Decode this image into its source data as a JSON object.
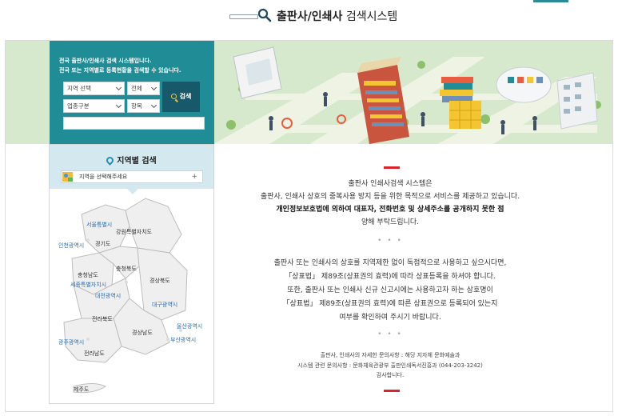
{
  "header": {
    "title_strong": "출판사/인쇄사",
    "title_rest": " 검색시스템"
  },
  "search": {
    "intro_line1": "전국 출판사/인쇄사 검색 시스템입니다.",
    "intro_line2": "전국 또는 지역별로 등록현황을 검색할 수 있습니다.",
    "region_select": "지역 선택",
    "scope_select": "전체",
    "business_select": "업종구분",
    "field_select": "항목",
    "button_label": "검색",
    "keyword_value": ""
  },
  "region": {
    "title": "지역별 검색",
    "select_placeholder": "지역을 선택해주세요",
    "plus": "+",
    "labels": [
      "서울특별시",
      "인천광역시",
      "경기도",
      "강원특별자치도",
      "충청남도",
      "세종특별자치시",
      "충청북도",
      "대전광역시",
      "경상북도",
      "대구광역시",
      "전라북도",
      "경상남도",
      "울산광역시",
      "광주광역시",
      "부산광역시",
      "전라남도",
      "제주도"
    ]
  },
  "notice": {
    "p1_line1": "출판사 인쇄사검색 시스템은",
    "p1_line2": "출판사, 인쇄사 상호의 중복사용 방지 등을 위한 목적으로 서비스를 제공하고 있습니다.",
    "p1_line3": "개인정보보호법에 의하여 대표자, 전화번호 및 상세주소를 공개하지 못한 점",
    "p1_line4": "양해 부탁드립니다.",
    "dots": "• • •",
    "p2_line1": "출판사 또는 인쇄사의 상호를 지역제한 없이 독점적으로 사용하고 싶으시다면,",
    "p2_line2": "「상표법」 제89조(상표권의 효력)에 따라 상표등록을 하셔야 합니다.",
    "p2_line3": "또한, 출판사 또는 인쇄사 신규 신고시에는 사용하고자 하는 상호명이",
    "p2_line4": "「상표법」 제89조(상표권의 효력)에 따른 상표권으로 등록되어 있는지",
    "p2_line5": "여부를 확인하여 주시기 바랍니다.",
    "p3_line1": "출판사, 인쇄사의 자세한 문의사항 : 해당 지자체 문화예술과",
    "p3_line2": "시스템 관련 문의사항 : 문화체육관광부 출판인쇄독서진흥과 (044-203-3242)",
    "p3_line3": "감사합니다."
  },
  "colors": {
    "teal": "#1f8c96",
    "dark_teal": "#17596b",
    "banner_green": "#d7e9cd",
    "accent_red": "#d9262d",
    "region_head": "#d4e8ef"
  },
  "icons": [
    "search-icon",
    "location-pin-icon",
    "map-icon",
    "plus-icon",
    "magnifier-icon"
  ]
}
